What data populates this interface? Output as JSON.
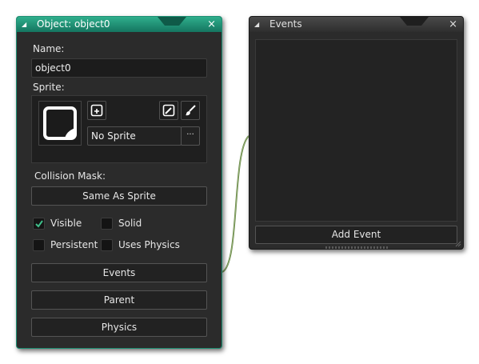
{
  "object_window": {
    "title": "Object: object0",
    "close_glyph": "×",
    "collapse_glyph": "◢",
    "name_label": "Name:",
    "name_value": "object0",
    "sprite_label": "Sprite:",
    "sprite_value": "No Sprite",
    "sprite_browse_glyph": "···",
    "collision_label": "Collision Mask:",
    "collision_value": "Same As Sprite",
    "checkboxes": [
      {
        "label": "Visible",
        "checked": true
      },
      {
        "label": "Solid",
        "checked": false
      },
      {
        "label": "Persistent",
        "checked": false
      },
      {
        "label": "Uses Physics",
        "checked": false
      }
    ],
    "buttons": {
      "events": "Events",
      "parent": "Parent",
      "physics": "Physics"
    },
    "icons": [
      "sprite-preview-icon",
      "new-sprite-icon",
      "edit-image-icon",
      "paint-brush-icon"
    ]
  },
  "events_window": {
    "title": "Events",
    "close_glyph": "×",
    "collapse_glyph": "◢",
    "add_event_label": "Add Event"
  },
  "colors": {
    "accent": "#1d8f73",
    "window_bg": "#2b2b2b",
    "check": "#3fbf8a"
  }
}
